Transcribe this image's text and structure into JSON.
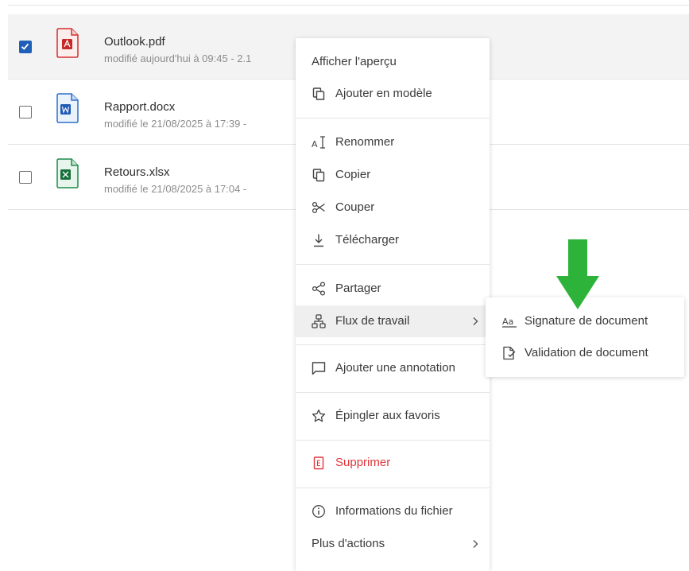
{
  "files": [
    {
      "name": "Outlook.pdf",
      "meta": "modifié aujourd'hui à 09:45  -  2.1",
      "type": "pdf",
      "checked": true
    },
    {
      "name": "Rapport.docx",
      "meta": "modifié le 21/08/2025 à 17:39  -",
      "type": "docx",
      "checked": false
    },
    {
      "name": "Retours.xlsx",
      "meta": "modifié le 21/08/2025 à 17:04  -",
      "type": "xlsx",
      "checked": false
    }
  ],
  "context_menu": {
    "preview": "Afficher l'aperçu",
    "add_template": "Ajouter en modèle",
    "rename": "Renommer",
    "copy": "Copier",
    "cut": "Couper",
    "download": "Télécharger",
    "share": "Partager",
    "workflow": "Flux de travail",
    "add_annotation": "Ajouter une annotation",
    "pin_favorites": "Épingler aux favoris",
    "delete": "Supprimer",
    "file_info": "Informations du fichier",
    "more_actions": "Plus d'actions"
  },
  "workflow_submenu": {
    "signature": "Signature de document",
    "validation": "Validation de document"
  },
  "colors": {
    "checkbox_checked": "#1f5fb8",
    "danger": "#e0353a",
    "pdf": "#d32f2f",
    "docx": "#2f6fc9",
    "xlsx": "#1e8a4c",
    "annotation_arrow": "#2db33a"
  },
  "icons": {
    "template": "copy-template-icon",
    "rename": "rename-icon",
    "copy": "copy-icon",
    "cut": "scissors-icon",
    "download": "download-icon",
    "share": "share-icon",
    "workflow": "workflow-icon",
    "annotation": "comment-icon",
    "favorite": "star-icon",
    "delete": "trash-icon",
    "info": "info-icon",
    "signature": "signature-icon",
    "validation": "document-check-icon"
  }
}
